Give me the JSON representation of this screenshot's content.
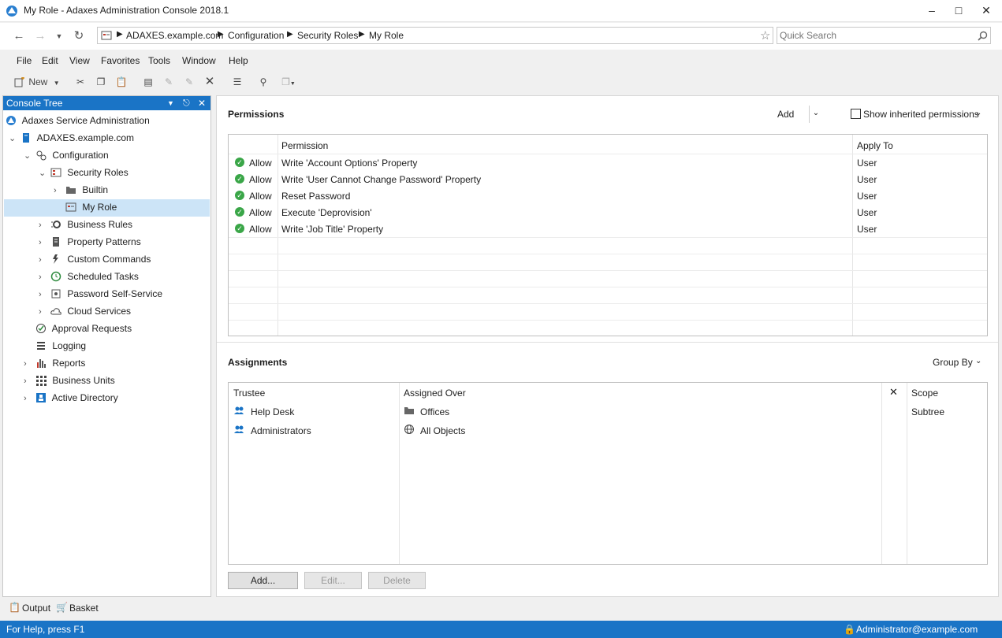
{
  "window": {
    "title": "My Role - Adaxes Administration Console 2018.1"
  },
  "address": {
    "segments": [
      "ADAXES.example.com",
      "Configuration",
      "Security Roles",
      "My Role"
    ],
    "search_placeholder": "Quick Search"
  },
  "menu": [
    "File",
    "Edit",
    "View",
    "Favorites",
    "Tools",
    "Window",
    "Help"
  ],
  "toolbar": {
    "new_label": "New"
  },
  "tree": {
    "header": "Console Tree",
    "nodes": [
      {
        "label": "Adaxes Service Administration",
        "icon": "adaxes-logo-icon"
      },
      {
        "label": "ADAXES.example.com",
        "icon": "server-icon"
      },
      {
        "label": "Configuration",
        "icon": "configuration-icon"
      },
      {
        "label": "Security Roles",
        "icon": "security-roles-icon"
      },
      {
        "label": "Builtin",
        "icon": "folder-icon"
      },
      {
        "label": "My Role",
        "icon": "security-role-icon"
      },
      {
        "label": "Business Rules",
        "icon": "business-rules-icon"
      },
      {
        "label": "Property Patterns",
        "icon": "property-patterns-icon"
      },
      {
        "label": "Custom Commands",
        "icon": "custom-commands-icon"
      },
      {
        "label": "Scheduled Tasks",
        "icon": "clock-icon"
      },
      {
        "label": "Password Self-Service",
        "icon": "password-self-service-icon"
      },
      {
        "label": "Cloud Services",
        "icon": "cloud-icon"
      },
      {
        "label": "Approval Requests",
        "icon": "approval-icon"
      },
      {
        "label": "Logging",
        "icon": "logging-icon"
      },
      {
        "label": "Reports",
        "icon": "reports-icon"
      },
      {
        "label": "Business Units",
        "icon": "business-units-icon"
      },
      {
        "label": "Active Directory",
        "icon": "active-directory-icon"
      }
    ]
  },
  "permissions": {
    "title": "Permissions",
    "add_label": "Add",
    "show_inherited_label": "Show inherited permissions",
    "columns": [
      "Permission",
      "Apply To"
    ],
    "rows": [
      {
        "type": "Allow",
        "permission": "Write 'Account Options' Property",
        "apply_to": "User"
      },
      {
        "type": "Allow",
        "permission": "Write 'User Cannot Change Password' Property",
        "apply_to": "User"
      },
      {
        "type": "Allow",
        "permission": "Reset Password",
        "apply_to": "User"
      },
      {
        "type": "Allow",
        "permission": "Execute 'Deprovision'",
        "apply_to": "User"
      },
      {
        "type": "Allow",
        "permission": "Write 'Job Title' Property",
        "apply_to": "User"
      }
    ]
  },
  "assignments": {
    "title": "Assignments",
    "group_by_label": "Group By",
    "columns": [
      "Trustee",
      "Assigned Over",
      "Scope"
    ],
    "trustees": [
      "Help Desk",
      "Administrators"
    ],
    "assigned_over": [
      {
        "label": "Offices",
        "scope": "Subtree",
        "icon": "folder-icon"
      },
      {
        "label": "All Objects",
        "scope": "",
        "icon": "globe-icon"
      }
    ],
    "buttons": {
      "add": "Add...",
      "edit": "Edit...",
      "delete": "Delete"
    }
  },
  "bottom_tabs": [
    "Output",
    "Basket"
  ],
  "status": {
    "help": "For Help, press F1",
    "user": "Administrator@example.com"
  },
  "colors": {
    "accent": "#1a74c6",
    "allow": "#3aa648"
  }
}
